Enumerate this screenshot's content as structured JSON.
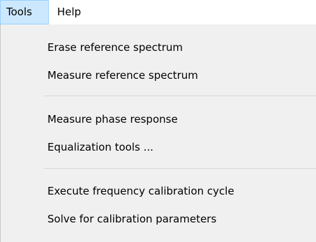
{
  "menubar": {
    "tools_label": "Tools",
    "help_label": "Help"
  },
  "tools_menu": {
    "items": [
      "Erase reference spectrum",
      "Measure reference spectrum",
      "Measure phase response",
      "Equalization tools ...",
      "Execute frequency calibration cycle",
      "Solve for calibration parameters"
    ]
  },
  "colors": {
    "menu_background": "#f0f0f0",
    "active_menubar_item": "#cce8ff",
    "active_menubar_border": "#99d1ff"
  }
}
